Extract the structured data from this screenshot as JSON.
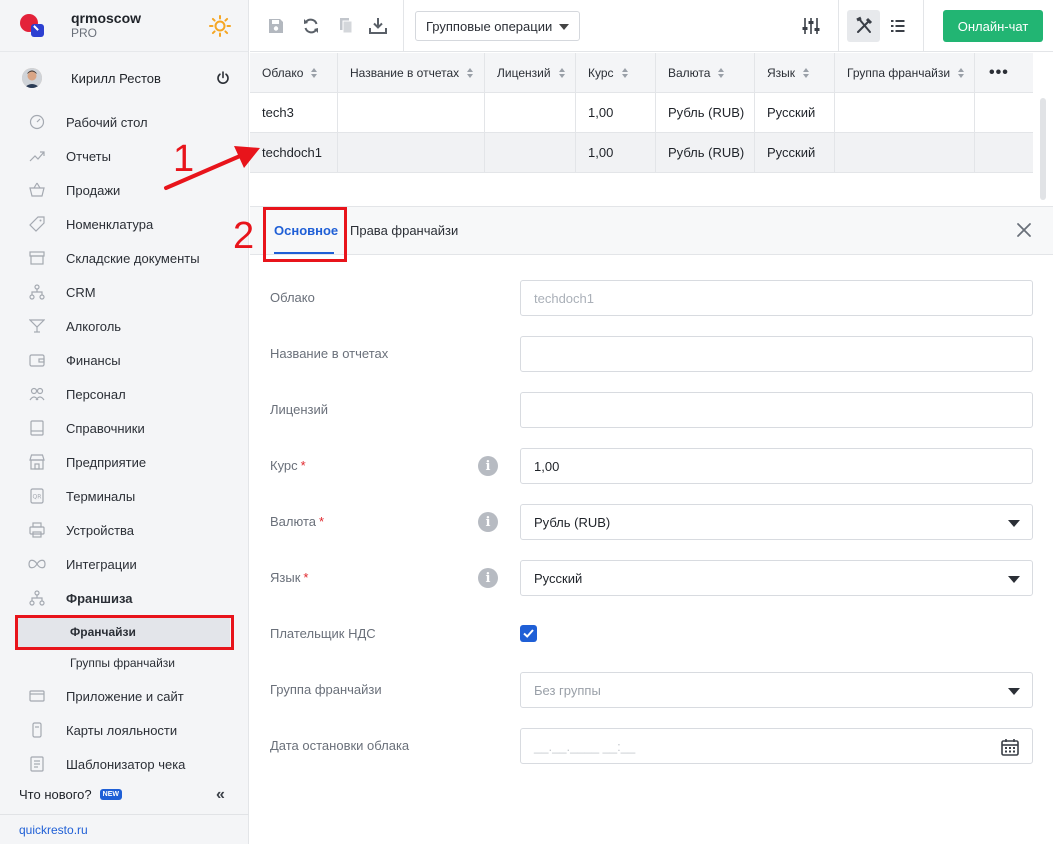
{
  "brand": {
    "name": "qrmoscow",
    "plan": "PRO"
  },
  "user": {
    "name": "Кирилл Рестов"
  },
  "sidebar": {
    "items": [
      {
        "label": "Рабочий стол",
        "icon": "gauge-icon"
      },
      {
        "label": "Отчеты",
        "icon": "chart-line-icon"
      },
      {
        "label": "Продажи",
        "icon": "basket-icon"
      },
      {
        "label": "Номенклатура",
        "icon": "tag-icon"
      },
      {
        "label": "Складские документы",
        "icon": "archive-icon"
      },
      {
        "label": "CRM",
        "icon": "org-chart-icon"
      },
      {
        "label": "Алкоголь",
        "icon": "cocktail-glass-icon"
      },
      {
        "label": "Финансы",
        "icon": "wallet-icon"
      },
      {
        "label": "Персонал",
        "icon": "people-icon"
      },
      {
        "label": "Справочники",
        "icon": "book-icon"
      },
      {
        "label": "Предприятие",
        "icon": "store-icon"
      },
      {
        "label": "Терминалы",
        "icon": "qr-terminal-icon"
      },
      {
        "label": "Устройства",
        "icon": "printer-icon"
      },
      {
        "label": "Интеграции",
        "icon": "infinity-icon"
      },
      {
        "label": "Франшиза",
        "icon": "org-chart-icon"
      }
    ],
    "franchise_sub": [
      {
        "label": "Франчайзи"
      },
      {
        "label": "Группы франчайзи"
      }
    ],
    "items_after": [
      {
        "label": "Приложение и сайт",
        "icon": "app-site-icon"
      },
      {
        "label": "Карты лояльности",
        "icon": "loyalty-card-icon"
      },
      {
        "label": "Шаблонизатор чека",
        "icon": "receipt-icon"
      }
    ],
    "whats_new": "Что нового?",
    "new_badge": "NEW",
    "site_link": "quickresto.ru"
  },
  "toolbar": {
    "group_ops_label": "Групповые операции",
    "chat_label": "Онлайн-чат"
  },
  "table": {
    "columns": [
      "Облако",
      "Название в отчетах",
      "Лицензий",
      "Курс",
      "Валюта",
      "Язык",
      "Группа франчайзи"
    ],
    "rows": [
      [
        "tech3",
        "",
        "",
        "1,00",
        "Рубль (RUB)",
        "Русский",
        ""
      ],
      [
        "techdoch1",
        "",
        "",
        "1,00",
        "Рубль (RUB)",
        "Русский",
        ""
      ]
    ]
  },
  "tabs": {
    "main": "Основное",
    "rights": "Права франчайзи"
  },
  "form": {
    "cloud": {
      "label": "Облако",
      "value": "techdoch1"
    },
    "report_name": {
      "label": "Название в отчетах",
      "value": ""
    },
    "licenses": {
      "label": "Лицензий",
      "value": ""
    },
    "rate": {
      "label": "Курс",
      "value": "1,00"
    },
    "currency": {
      "label": "Валюта",
      "value": "Рубль (RUB)"
    },
    "language": {
      "label": "Язык",
      "value": "Русский"
    },
    "vat": {
      "label": "Плательщик НДС",
      "checked": true
    },
    "group": {
      "label": "Группа франчайзи",
      "value": "Без группы"
    },
    "stop_date": {
      "label": "Дата остановки облака",
      "placeholder": "__.__.____ __:__"
    },
    "required_mark": "*",
    "info_mark": "i"
  },
  "annotations": {
    "one": "1",
    "two": "2"
  },
  "colors": {
    "accent": "#1f5fd6",
    "chat": "#22b573",
    "annotation": "#e8141b"
  }
}
